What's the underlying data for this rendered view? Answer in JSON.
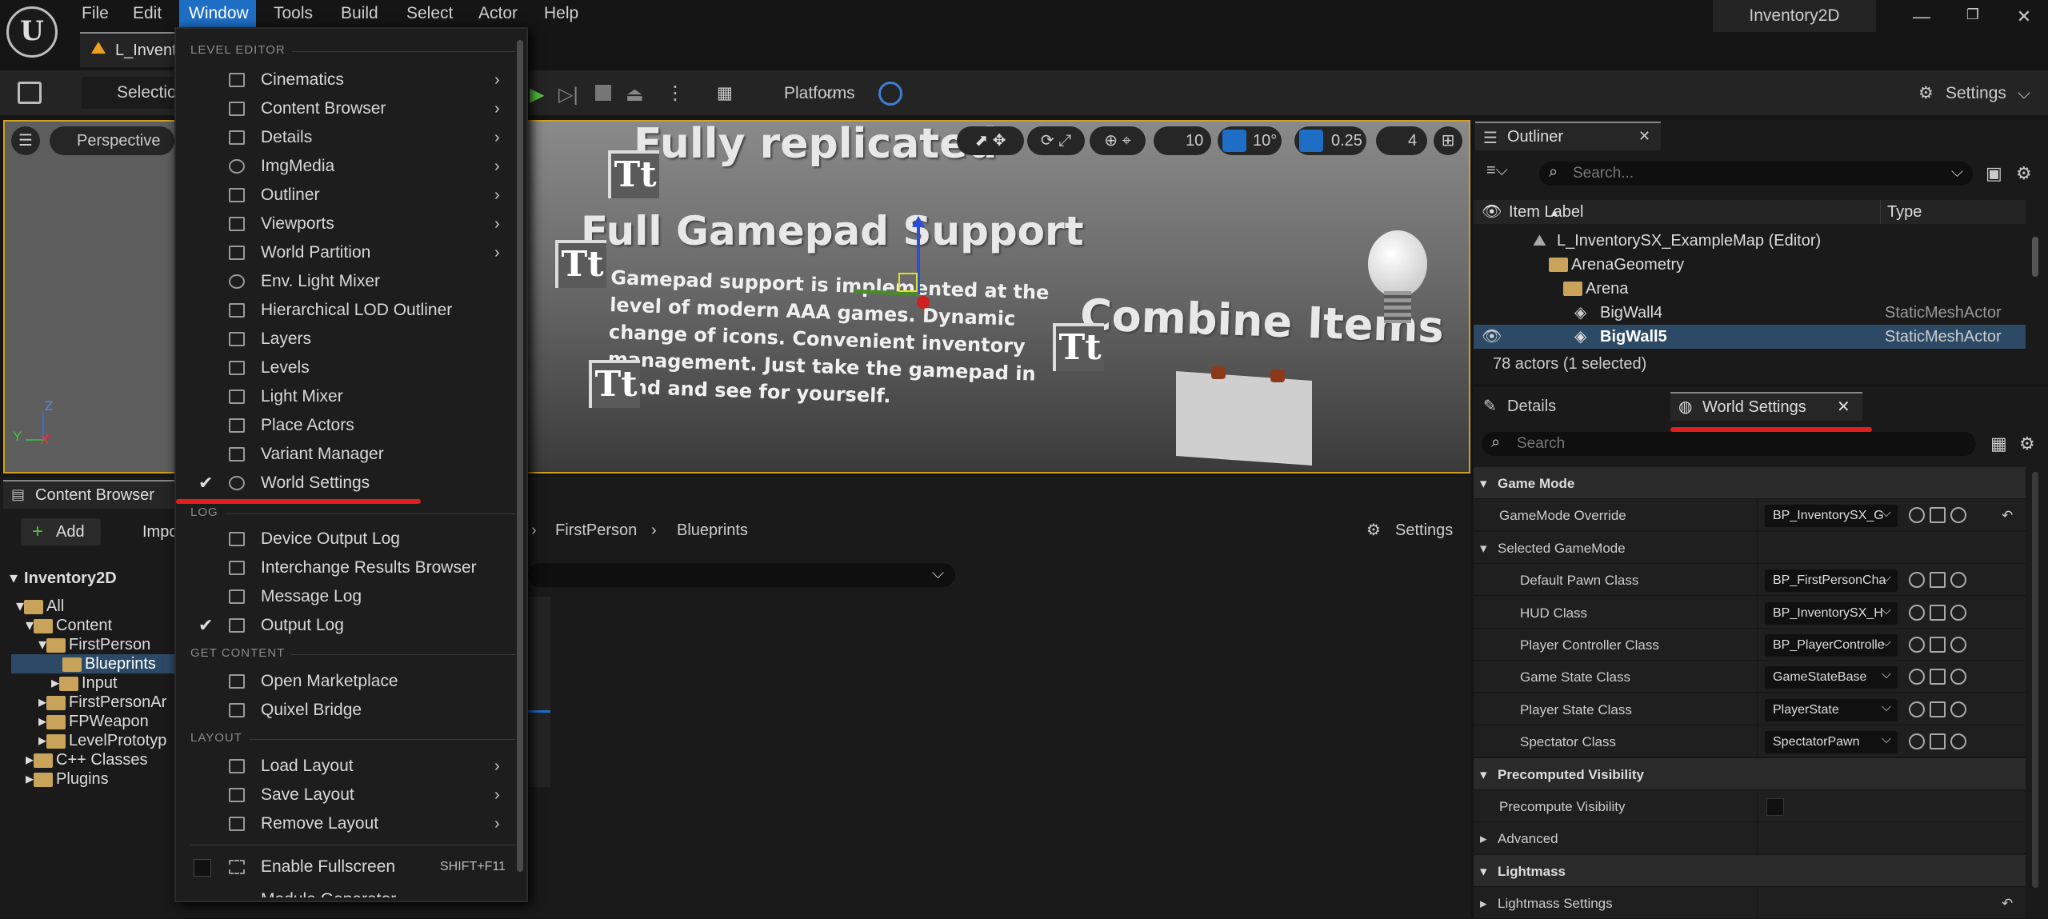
{
  "app": {
    "project_name": "Inventory2D",
    "level_tab": "L_Invent"
  },
  "menubar": {
    "items": [
      "File",
      "Edit",
      "Window",
      "Tools",
      "Build",
      "Select",
      "Actor",
      "Help"
    ],
    "active": "Window"
  },
  "toolbar": {
    "selection_label": "Selectio",
    "platforms_label": "Platforms",
    "settings_label": "Settings"
  },
  "viewport": {
    "perspective_label": "Perspective",
    "grid_value": "10",
    "angle_value": "10°",
    "scale_value": "0.25",
    "camera_speed": "4",
    "scene_texts": {
      "replicated": "Fully replicated",
      "gamepad_title": "Full Gamepad Support",
      "gamepad_body": [
        "Gamepad support is implemented at the",
        "level of modern AAA games. Dynamic",
        "change of icons. Convenient inventory",
        "management. Just take the gamepad in",
        "hand and see for yourself."
      ],
      "combine": "Combine Items",
      "tt": "Tt"
    },
    "axis_z": "Z",
    "axis_x": "X",
    "axis_y": "Y"
  },
  "window_menu": {
    "sections": [
      {
        "title": "LEVEL EDITOR",
        "items": [
          {
            "label": "Cinematics",
            "arrow": true
          },
          {
            "label": "Content Browser",
            "arrow": true
          },
          {
            "label": "Details",
            "arrow": true
          },
          {
            "label": "ImgMedia",
            "arrow": true
          },
          {
            "label": "Outliner",
            "arrow": true
          },
          {
            "label": "Viewports",
            "arrow": true
          },
          {
            "label": "World Partition",
            "arrow": true
          },
          {
            "label": "Env. Light Mixer"
          },
          {
            "label": "Hierarchical LOD Outliner"
          },
          {
            "label": "Layers"
          },
          {
            "label": "Levels"
          },
          {
            "label": "Light Mixer"
          },
          {
            "label": "Place Actors"
          },
          {
            "label": "Variant Manager"
          },
          {
            "label": "World Settings",
            "checked": true
          }
        ]
      },
      {
        "title": "LOG",
        "items": [
          {
            "label": "Device Output Log"
          },
          {
            "label": "Interchange Results Browser"
          },
          {
            "label": "Message Log"
          },
          {
            "label": "Output Log",
            "checked": true
          }
        ]
      },
      {
        "title": "GET CONTENT",
        "items": [
          {
            "label": "Open Marketplace"
          },
          {
            "label": "Quixel Bridge"
          }
        ]
      },
      {
        "title": "LAYOUT",
        "items": [
          {
            "label": "Load Layout",
            "arrow": true
          },
          {
            "label": "Save Layout",
            "arrow": true
          },
          {
            "label": "Remove Layout",
            "arrow": true
          }
        ]
      }
    ],
    "fullscreen": {
      "label": "Enable Fullscreen",
      "shortcut": "SHIFT+F11"
    },
    "cut_item": "Module Generator"
  },
  "content_browser": {
    "tab": "Content Browser",
    "add_label": "Add",
    "import_label": "Impo",
    "root": "Inventory2D",
    "tree": [
      "All",
      "Content",
      "FirstPerson",
      "Blueprints",
      "Input",
      "FirstPersonAr",
      "FPWeapon",
      "LevelPrototyp",
      "C++ Classes",
      "Plugins"
    ],
    "breadcrumb": [
      "FirstPerson",
      "Blueprints"
    ],
    "settings_label": "Settings"
  },
  "outliner": {
    "tab": "Outliner",
    "search_placeholder": "Search...",
    "col_label": "Item Label",
    "col_type": "Type",
    "rows": [
      {
        "label": "L_InventorySX_ExampleMap (Editor)",
        "type": ""
      },
      {
        "label": "ArenaGeometry",
        "type": ""
      },
      {
        "label": "Arena",
        "type": ""
      },
      {
        "label": "BigWall4",
        "type": "StaticMeshActor"
      },
      {
        "label": "BigWall5",
        "type": "StaticMeshActor"
      }
    ],
    "status": "78 actors (1 selected)"
  },
  "details": {
    "tab_details": "Details",
    "tab_world": "World Settings",
    "search_placeholder": "Search",
    "rows": [
      {
        "name": "Game Mode",
        "cat": true
      },
      {
        "name": "GameMode Override",
        "value": "BP_InventorySX_G"
      },
      {
        "name": "Selected GameMode",
        "cat": false,
        "sub": true
      },
      {
        "name": "Default Pawn Class",
        "value": "BP_FirstPersonCha"
      },
      {
        "name": "HUD Class",
        "value": "BP_InventorySX_H"
      },
      {
        "name": "Player Controller Class",
        "value": "BP_PlayerControlle"
      },
      {
        "name": "Game State Class",
        "value": "GameStateBase"
      },
      {
        "name": "Player State Class",
        "value": "PlayerState"
      },
      {
        "name": "Spectator Class",
        "value": "SpectatorPawn"
      },
      {
        "name": "Precomputed Visibility",
        "cat": true
      },
      {
        "name": "Precompute Visibility"
      },
      {
        "name": "Advanced"
      },
      {
        "name": "Lightmass",
        "cat": true
      },
      {
        "name": "Lightmass Settings"
      }
    ]
  },
  "colors": {
    "accent": "#1e6ec6",
    "highlight_red": "#e0201c",
    "selection": "#2c4a66",
    "viewport_border": "#d4a020"
  }
}
